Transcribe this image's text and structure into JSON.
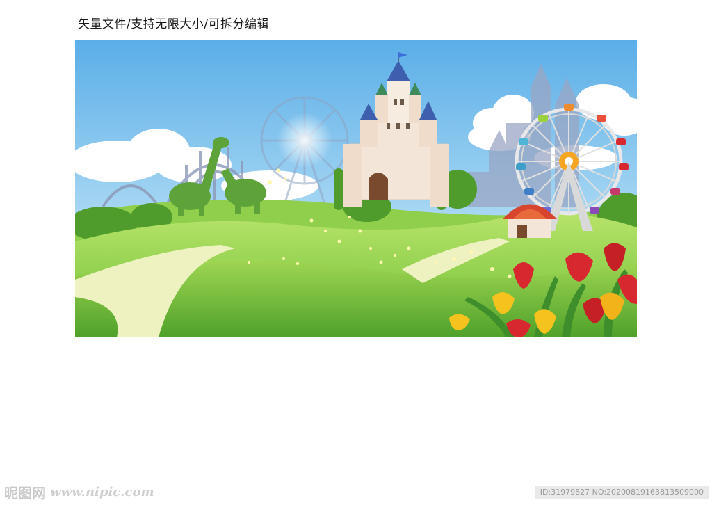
{
  "caption": "矢量文件/支持无限大小/可拆分编辑",
  "watermark": {
    "brand": "昵图网",
    "domain": "www.nipic.com",
    "id_info": "ID:31979827 NO:20200819163813509000"
  },
  "colors": {
    "sky_top": "#5fb0e8",
    "sky_bottom": "#c9e8f7",
    "grass_light": "#a8dc5a",
    "grass_dark": "#5fae2c",
    "path": "#eef2c0",
    "castle": "#f3e6d8",
    "roof": "#3e5fae",
    "tulip_red": "#d8282f",
    "tulip_yellow": "#f5c21e"
  }
}
